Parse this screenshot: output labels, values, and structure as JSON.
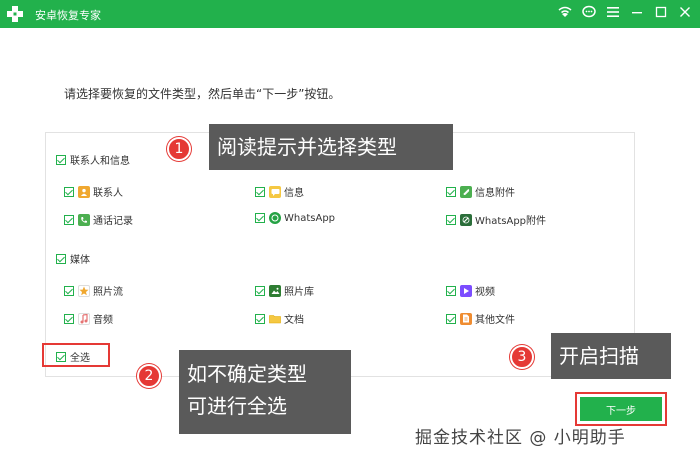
{
  "titlebar": {
    "app_title": "安卓恢复专家",
    "icons": [
      "logo-icon",
      "wifi-icon",
      "chat-icon",
      "menu-icon",
      "minimize-icon",
      "maximize-icon",
      "close-icon"
    ]
  },
  "instruction": "请选择要恢复的文件类型，然后单击“下一步”按钮。",
  "groups": [
    {
      "label": "联系人和信息",
      "items": [
        {
          "label": "联系人",
          "icon": "contacts-icon",
          "color": "#f0a830"
        },
        {
          "label": "信息",
          "icon": "message-icon",
          "color": "#f5c842"
        },
        {
          "label": "信息附件",
          "icon": "attachment-icon",
          "color": "#4caf50"
        },
        {
          "label": "通话记录",
          "icon": "phone-icon",
          "color": "#4caf50"
        },
        {
          "label": "WhatsApp",
          "icon": "whatsapp-icon",
          "color": "#25a244"
        },
        {
          "label": "WhatsApp附件",
          "icon": "whatsapp-attachment-icon",
          "color": "#2b6e3a"
        }
      ]
    },
    {
      "label": "媒体",
      "items": [
        {
          "label": "照片流",
          "icon": "star-icon",
          "color": "#f0a830"
        },
        {
          "label": "照片库",
          "icon": "gallery-icon",
          "color": "#2e7d32"
        },
        {
          "label": "视频",
          "icon": "video-icon",
          "color": "#7c4dff"
        },
        {
          "label": "音频",
          "icon": "music-icon",
          "color": "#e57373"
        },
        {
          "label": "文档",
          "icon": "folder-icon",
          "color": "#f5c842"
        },
        {
          "label": "其他文件",
          "icon": "file-icon",
          "color": "#ef8c30"
        }
      ]
    }
  ],
  "select_all": "全选",
  "next_button": "下一步",
  "callouts": [
    {
      "num": "1",
      "text": "阅读提示并选择类型"
    },
    {
      "num": "2",
      "text": "如不确定类型",
      "text2": "可进行全选"
    },
    {
      "num": "3",
      "text": "开启扫描"
    }
  ],
  "watermark": "掘金技术社区 @ 小明助手",
  "colors": {
    "brand": "#22b14c",
    "annotation": "#e53935",
    "callout_bg": "#5a5a5a"
  }
}
